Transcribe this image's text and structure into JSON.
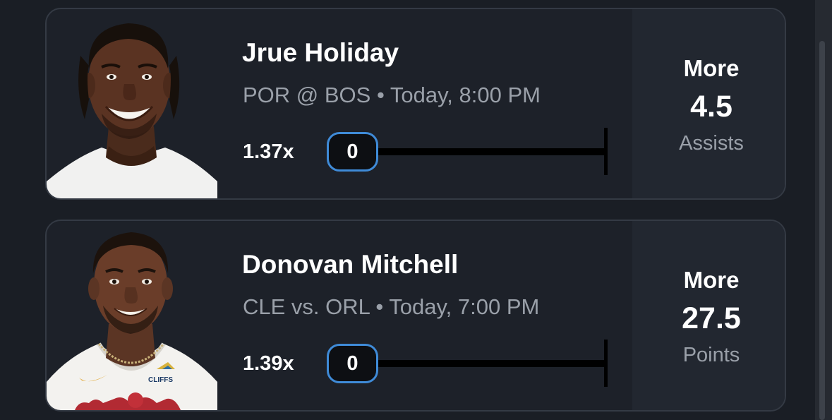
{
  "colors": {
    "background": "#1a1e25",
    "card": "#1d2129",
    "card_border": "#343a44",
    "accent_pill_border": "#3f8bd8",
    "muted_text": "#9aa0a9"
  },
  "props": [
    {
      "player_name": "Jrue Holiday",
      "matchup": "POR @ BOS • Today, 8:00 PM",
      "multiplier": "1.37x",
      "progress_value": "0",
      "direction": "More",
      "line": "4.5",
      "stat": "Assists",
      "jersey_icon": "white-jersey-headshot"
    },
    {
      "player_name": "Donovan Mitchell",
      "matchup": "CLE vs. ORL • Today, 7:00 PM",
      "multiplier": "1.39x",
      "progress_value": "0",
      "direction": "More",
      "line": "27.5",
      "stat": "Points",
      "jersey_icon": "cavaliers-jersey-headshot"
    }
  ]
}
